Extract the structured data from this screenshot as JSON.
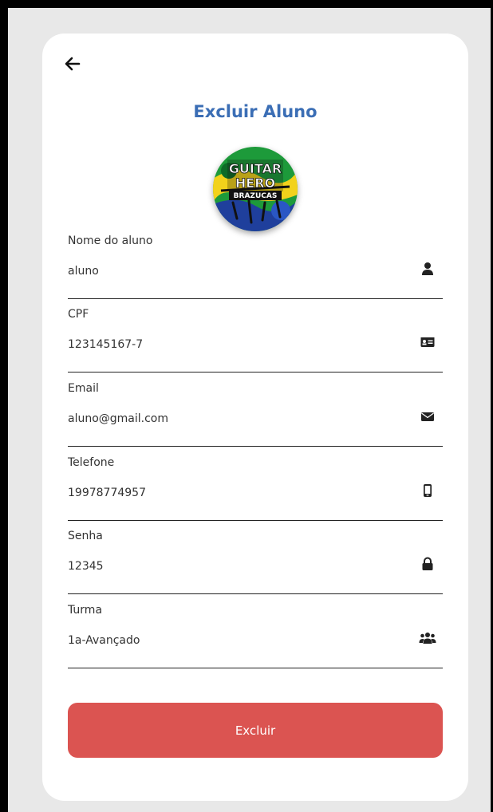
{
  "page": {
    "title": "Excluir Aluno",
    "logo_text": [
      "GUITAR",
      "HERO",
      "BRAZUCAS"
    ]
  },
  "fields": [
    {
      "label": "Nome do aluno",
      "value": "aluno",
      "icon": "user-icon"
    },
    {
      "label": "CPF",
      "value": "123145167-7",
      "icon": "id-card-icon"
    },
    {
      "label": "Email",
      "value": "aluno@gmail.com",
      "icon": "envelope-icon"
    },
    {
      "label": "Telefone",
      "value": "19978774957",
      "icon": "mobile-phone-icon"
    },
    {
      "label": "Senha",
      "value": "12345",
      "icon": "lock-icon"
    },
    {
      "label": "Turma",
      "value": "1a-Avançado",
      "icon": "users-icon"
    }
  ],
  "actions": {
    "delete_label": "Excluir"
  },
  "colors": {
    "title": "#3b6eb5",
    "button": "#db5451",
    "background": "#e8e8e8"
  }
}
